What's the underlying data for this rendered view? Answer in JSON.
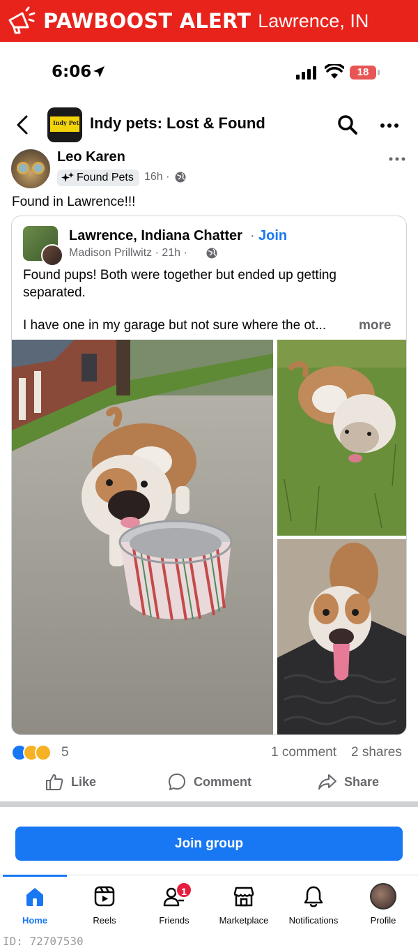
{
  "alert": {
    "brand": "PAWBOOST ALERT",
    "location": "Lawrence, IN",
    "color": "#e8231c"
  },
  "status_bar": {
    "time": "6:06",
    "battery": "18"
  },
  "group": {
    "title": "Indy pets: Lost & Found",
    "thumb_text": "Indy Pets"
  },
  "post": {
    "author": "Leo Karen",
    "badge": "Found Pets",
    "time": "16h ·",
    "text": "Found in Lawrence!!!"
  },
  "shared": {
    "group_name": "Lawrence, Indiana Chatter",
    "separator": "·",
    "join_label": "Join",
    "author_line": "Madison Prillwitz · 21h ·",
    "text1": "Found pups! Both were together but ended up getting separated.",
    "text2": "I have one in my garage but not sure where the ot...",
    "more_label": "more"
  },
  "engagement": {
    "reactions": "5",
    "comments": "1 comment",
    "shares": "2 shares"
  },
  "actions": {
    "like": "Like",
    "comment": "Comment",
    "share": "Share"
  },
  "join_group": "Join group",
  "nav": {
    "home": "Home",
    "reels": "Reels",
    "friends": "Friends",
    "friends_badge": "1",
    "marketplace": "Marketplace",
    "notifications": "Notifications",
    "profile": "Profile"
  },
  "id_label": "ID: 72707530",
  "colors": {
    "accent": "#1877f2",
    "badge_red": "#e41e3f",
    "secondary_text": "#65676b"
  }
}
